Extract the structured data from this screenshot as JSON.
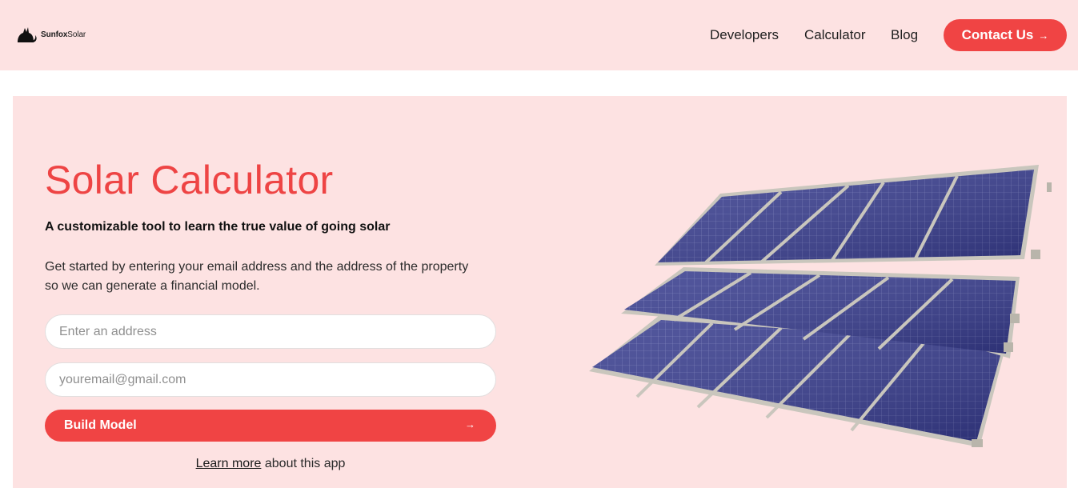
{
  "header": {
    "logo": {
      "brand_bold": "Sunfox",
      "brand_light": "Solar",
      "icon": "fox-icon"
    },
    "nav": [
      {
        "label": "Developers"
      },
      {
        "label": "Calculator"
      },
      {
        "label": "Blog"
      }
    ],
    "contact": {
      "label": "Contact Us",
      "arrow": "→"
    }
  },
  "hero": {
    "title": "Solar Calculator",
    "subtitle": "A customizable tool to learn the true value of going solar",
    "description": "Get started by entering your email address and the address of the property so we can generate a financial model.",
    "address_field": {
      "value": "",
      "placeholder": "Enter an address"
    },
    "email_field": {
      "value": "",
      "placeholder": "youremail@gmail.com"
    },
    "build_button": {
      "label": "Build Model",
      "arrow": "→"
    },
    "learn_more": {
      "link": "Learn more",
      "rest": " about this app"
    },
    "image": "solar-panels-image"
  },
  "colors": {
    "accent": "#f04444",
    "background_pink": "#fde2e2",
    "panel_blue": "#3a3f8f"
  }
}
